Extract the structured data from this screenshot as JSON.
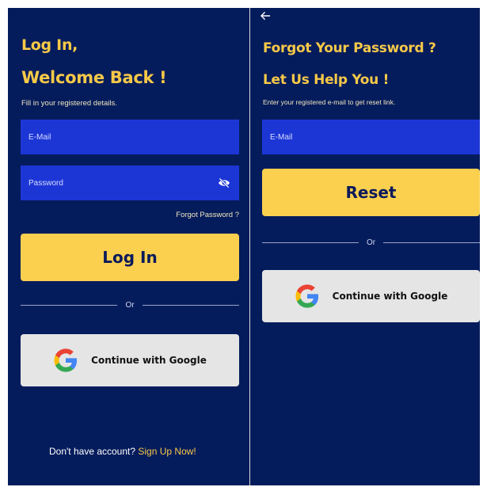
{
  "login": {
    "title_line1": "Log In,",
    "title_line2": "Welcome Back !",
    "subtitle": "Fill in your registered details.",
    "email_placeholder": "E-Mail",
    "password_placeholder": "Password",
    "forgot_password_link": "Forgot Password ?",
    "login_button": "Log In",
    "or_text": "Or",
    "google_button": "Continue with Google",
    "footer_prompt": "Don't have account?",
    "signup_link": "Sign Up Now!"
  },
  "forgot": {
    "back_icon": "back-arrow-icon",
    "title_line1": "Forgot Your Password ?",
    "title_line2": "Let Us Help You !",
    "subtitle": "Enter your registered e-mail to get reset link.",
    "email_placeholder": "E-Mail",
    "reset_button": "Reset",
    "or_text": "Or",
    "google_button": "Continue with Google"
  },
  "colors": {
    "background": "#051c5c",
    "accent_yellow": "#fcd04f",
    "title_yellow": "#f7c948",
    "input_blue": "#1c36d6",
    "google_button_bg": "#e5e5e5"
  }
}
